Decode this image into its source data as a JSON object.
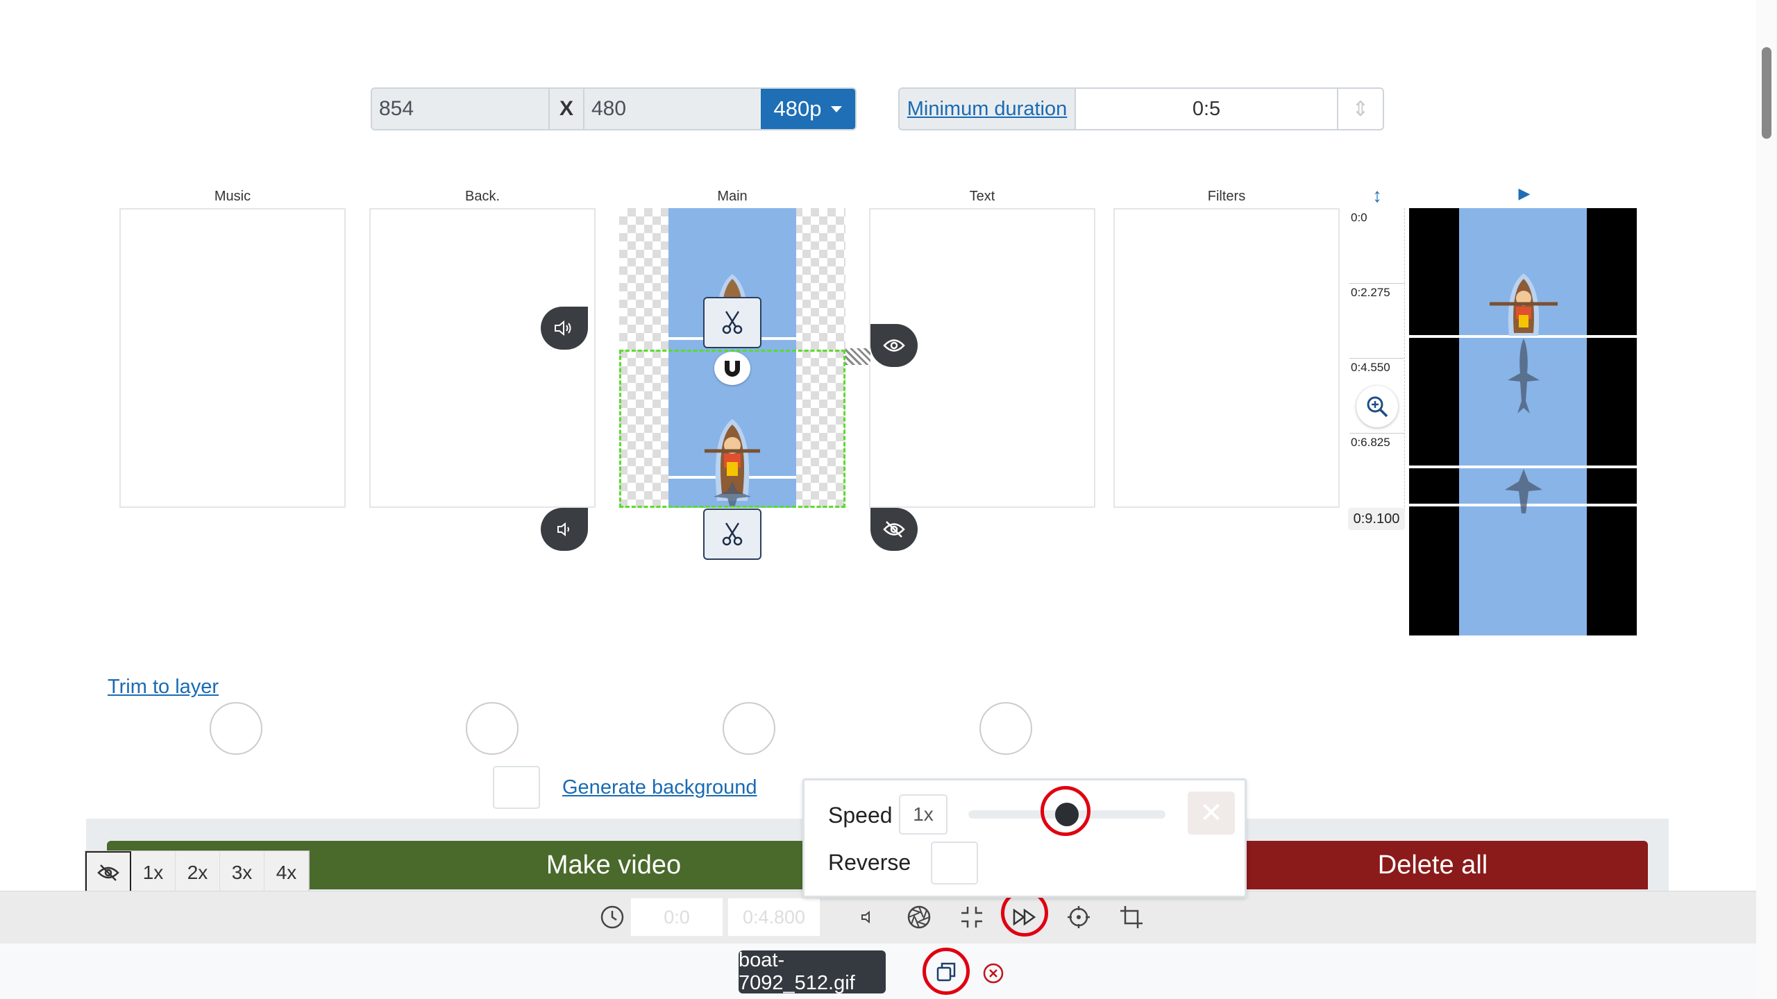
{
  "resolution": {
    "width": "854",
    "x_label": "X",
    "height": "480",
    "preset": "480p"
  },
  "duration": {
    "label": "Minimum duration",
    "value": "0:5"
  },
  "tracks": {
    "music": "Music",
    "back": "Back.",
    "main": "Main",
    "text": "Text",
    "filters": "Filters"
  },
  "timeline": {
    "ticks": [
      "0:0",
      "0:2.275",
      "0:4.550",
      "0:6.825",
      "0:9.100"
    ]
  },
  "links": {
    "trim_to_layer": "Trim to layer",
    "generate_background": "Generate background"
  },
  "buttons": {
    "make_video": "Make video",
    "delete_all": "Delete all"
  },
  "zoom": {
    "options": [
      "1x",
      "2x",
      "3x",
      "4x"
    ]
  },
  "toolbar": {
    "start_time": "0:0",
    "end_time": "0:4.800"
  },
  "file": {
    "name": "boat-7092_512.gif"
  },
  "speed_popup": {
    "speed_label": "Speed",
    "speed_value": "1x",
    "reverse_label": "Reverse",
    "slider_level": 0.5
  },
  "colors": {
    "primary": "#1e6fb5",
    "make_video": "#4a6a2c",
    "delete_all": "#8b1a1a",
    "sky": "#88b4e8",
    "highlight": "#e00010"
  }
}
